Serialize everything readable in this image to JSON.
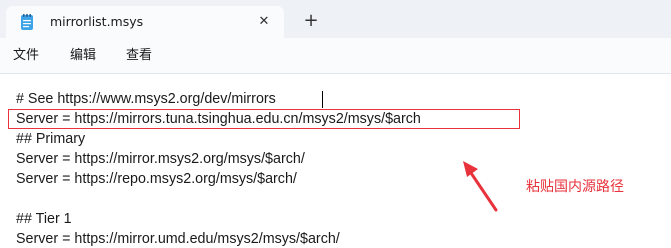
{
  "window": {
    "tab_title": "mirrorlist.msys",
    "tab_icon": "notepad-icon",
    "close_icon": "close-icon",
    "new_tab_icon": "plus-icon"
  },
  "menu": {
    "items": [
      "文件",
      "编辑",
      "查看"
    ]
  },
  "editor": {
    "lines": [
      "# See https://www.msys2.org/dev/mirrors",
      "Server = https://mirrors.tuna.tsinghua.edu.cn/msys2/msys/$arch",
      "## Primary",
      "Server = https://mirror.msys2.org/msys/$arch/",
      "Server = https://repo.msys2.org/msys/$arch/",
      "",
      "## Tier 1",
      "Server = https://mirror.umd.edu/msys2/msys/$arch/"
    ]
  },
  "annotation": {
    "text": "粘贴国内源路径",
    "color": "#e8323c"
  },
  "colors": {
    "tabstrip_bg": "#eef2f7",
    "tab_bg": "#f9fbfd",
    "annotation_red": "#e8323c"
  }
}
